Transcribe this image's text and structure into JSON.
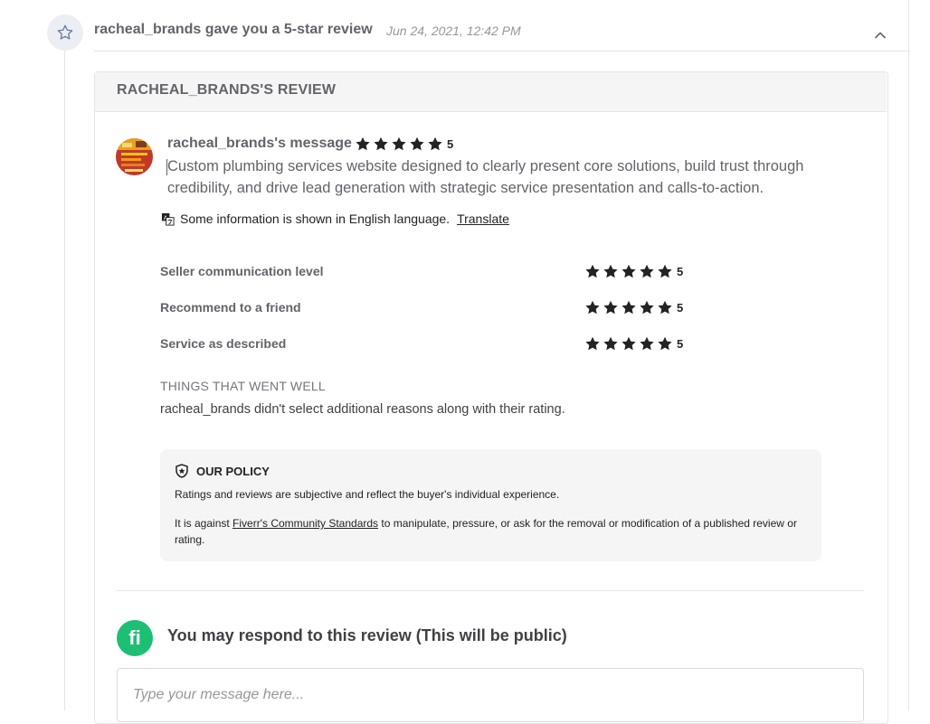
{
  "header": {
    "title": "racheal_brands gave you a 5-star review",
    "date": "Jun 24, 2021, 12:42 PM"
  },
  "card": {
    "title": "RACHEAL_BRANDS'S REVIEW",
    "message": {
      "author": "racheal_brands's message",
      "rating": "5",
      "text": "Custom plumbing services website designed to clearly present core solutions, build trust through credibility, and drive lead generation with strategic service presentation and calls-to-action."
    },
    "language_notice": "Some information is shown in English language.",
    "translate_label": "Translate",
    "ratings": [
      {
        "label": "Seller communication level",
        "value": "5"
      },
      {
        "label": "Recommend to a friend",
        "value": "5"
      },
      {
        "label": "Service as described",
        "value": "5"
      }
    ],
    "things_went_well": {
      "title": "THINGS THAT WENT WELL",
      "text": "racheal_brands didn't select additional reasons along with their rating."
    },
    "policy": {
      "title": "OUR POLICY",
      "p1": "Ratings and reviews are subjective and reflect the buyer's individual experience.",
      "p2_before": "It is against ",
      "p2_link": "Fiverr's Community Standards",
      "p2_after": " to manipulate, pressure, or ask for the removal or modification of a published review or rating."
    },
    "respond": {
      "logo_text": "fi",
      "title": "You may respond to this review (This will be public)",
      "placeholder": "Type your message here..."
    }
  },
  "icons": {
    "timeline": "star-outline-icon",
    "collapse": "chevron-up-icon",
    "translate": "translate-icon",
    "policy": "shield-star-icon"
  },
  "colors": {
    "brand_green": "#1dbf73",
    "star": "#222325",
    "timeline_badge": "#eceef3"
  }
}
